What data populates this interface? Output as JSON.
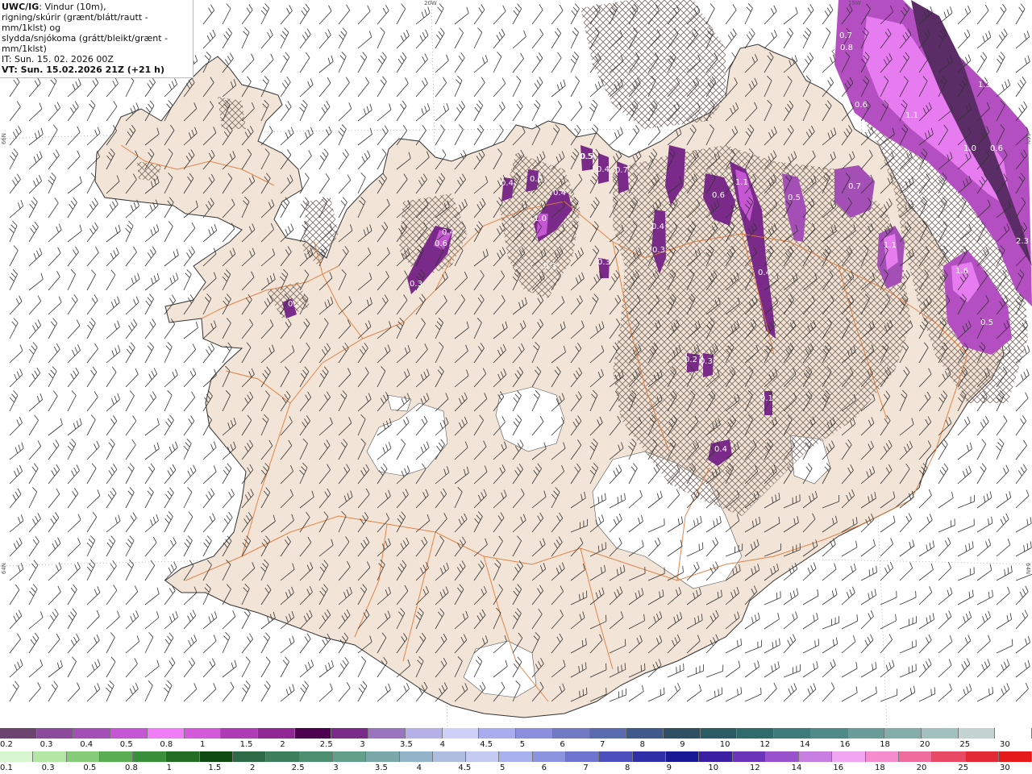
{
  "header": {
    "product": "UWC/IG",
    "line1_rest": ": Vindur (10m),",
    "line2": "rigning/skúrir (grænt/blátt/rautt - mm/1klst) og",
    "line3": "slydda/snjókoma (grátt/bleikt/grænt - mm/1klst)",
    "it": "IT: Sun. 15. 02. 2026 00Z",
    "vt": "VT: Sun. 15.02.2026 21Z (+21 h)"
  },
  "graticule": {
    "top_lon_20w": "20W",
    "top_lon_15w": "15W",
    "left_lat_66n": "66N",
    "left_lat_64n": "64N",
    "right_lat_66n": "66N",
    "right_lat_64n": "64N"
  },
  "precip_labels": [
    "0.7",
    "0.8",
    "1.3",
    "0.6",
    "1.1",
    "1.0",
    "0.6",
    "2.3",
    "0.5",
    "0.4",
    "0.7",
    "0.4",
    "0.6",
    "0.4",
    "1.0",
    "0.5",
    "1.1",
    "0.6",
    "1.1",
    "0.5",
    "0.7",
    "0.4",
    "0.3",
    "0.4",
    "0.3",
    "0.3",
    "0.6",
    "0.3",
    "0.4",
    "0.3",
    "0.2",
    "0.3",
    "0.4",
    "1.6",
    "0.5",
    "0.1"
  ],
  "legend_top": {
    "colors": [
      "#6b4470",
      "#8c4a9a",
      "#a34fb5",
      "#c556d4",
      "#f07df5",
      "#d35ad8",
      "#b03cb5",
      "#8f2794",
      "#4d0050",
      "#7a2a88",
      "#9975c0",
      "#b6b0e8",
      "#cfd0f7",
      "#a9acee",
      "#8c8fde",
      "#7279c5",
      "#5a6bb0",
      "#3f5a8a",
      "#2f4f62",
      "#2b5c63",
      "#2f6b6c",
      "#3d7a7a",
      "#4f8a89",
      "#6a9c99",
      "#85aeab",
      "#a2c0bd",
      "#c3d4d0",
      "#ffffff"
    ],
    "labels": [
      "0.2",
      "0.3",
      "0.4",
      "0.5",
      "0.8",
      "1",
      "1.5",
      "2",
      "2.5",
      "3",
      "3.5",
      "4",
      "4.5",
      "5",
      "6",
      "7",
      "8",
      "9",
      "10",
      "12",
      "14",
      "16",
      "18",
      "20",
      "25",
      "30"
    ]
  },
  "legend_bottom": {
    "colors": [
      "#d7f5cf",
      "#b4e6a6",
      "#86cc78",
      "#5aae52",
      "#3a8f3a",
      "#226d24",
      "#0f4a13",
      "#2d6a45",
      "#3d7e5c",
      "#4e8f72",
      "#63a08a",
      "#7aa8a8",
      "#93b4c8",
      "#aebde0",
      "#c4caf2",
      "#a9b0ee",
      "#8c94e0",
      "#6e74cf",
      "#4d4fbc",
      "#2f2fa8",
      "#191993",
      "#3b1fa3",
      "#6a35b8",
      "#9a52cc",
      "#c77ee0",
      "#f0a6f0",
      "#f58ccd",
      "#ef6d9d",
      "#e84a66",
      "#e12a34",
      "#e51a1a"
    ],
    "labels": [
      "0.1",
      "0.3",
      "0.5",
      "0.8",
      "1",
      "1.5",
      "2",
      "2.5",
      "3",
      "3.5",
      "4",
      "4.5",
      "5",
      "6",
      "7",
      "8",
      "9",
      "10",
      "12",
      "14",
      "16",
      "18",
      "20",
      "25",
      "30"
    ]
  }
}
